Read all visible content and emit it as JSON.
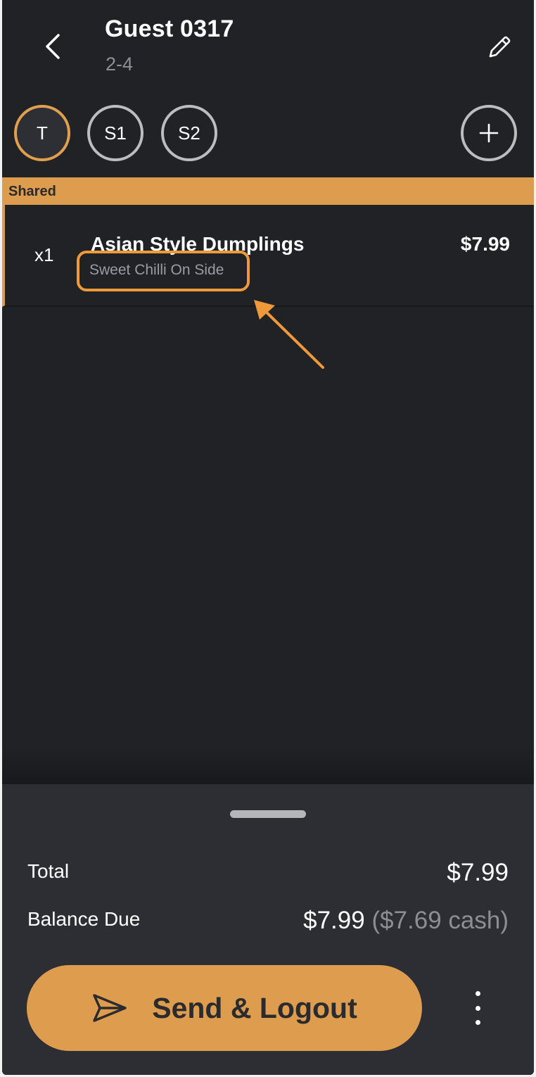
{
  "header": {
    "title": "Guest 0317",
    "subtitle": "2-4"
  },
  "seats": [
    {
      "label": "T",
      "active": true
    },
    {
      "label": "S1",
      "active": false
    },
    {
      "label": "S2",
      "active": false
    }
  ],
  "add_seat_symbol": "+",
  "section": {
    "label": "Shared"
  },
  "items": [
    {
      "qty": "x1",
      "name": "Asian Style Dumplings",
      "price": "$7.99",
      "modifier": "Sweet Chilli On Side"
    }
  ],
  "summary": {
    "total_label": "Total",
    "total_value": "$7.99",
    "balance_label": "Balance Due",
    "balance_value": "$7.99",
    "balance_cash": "($7.69 cash)"
  },
  "actions": {
    "send_label": "Send & Logout"
  },
  "icons": {
    "back": "chevron-left-icon",
    "edit": "pencil-icon",
    "add": "plus-icon",
    "send": "send-icon",
    "more": "more-vertical-icon"
  },
  "colors": {
    "background": "#212226",
    "accent": "#dd9c4e",
    "annotation": "#ef9a3a",
    "panel": "#2d2e33"
  }
}
